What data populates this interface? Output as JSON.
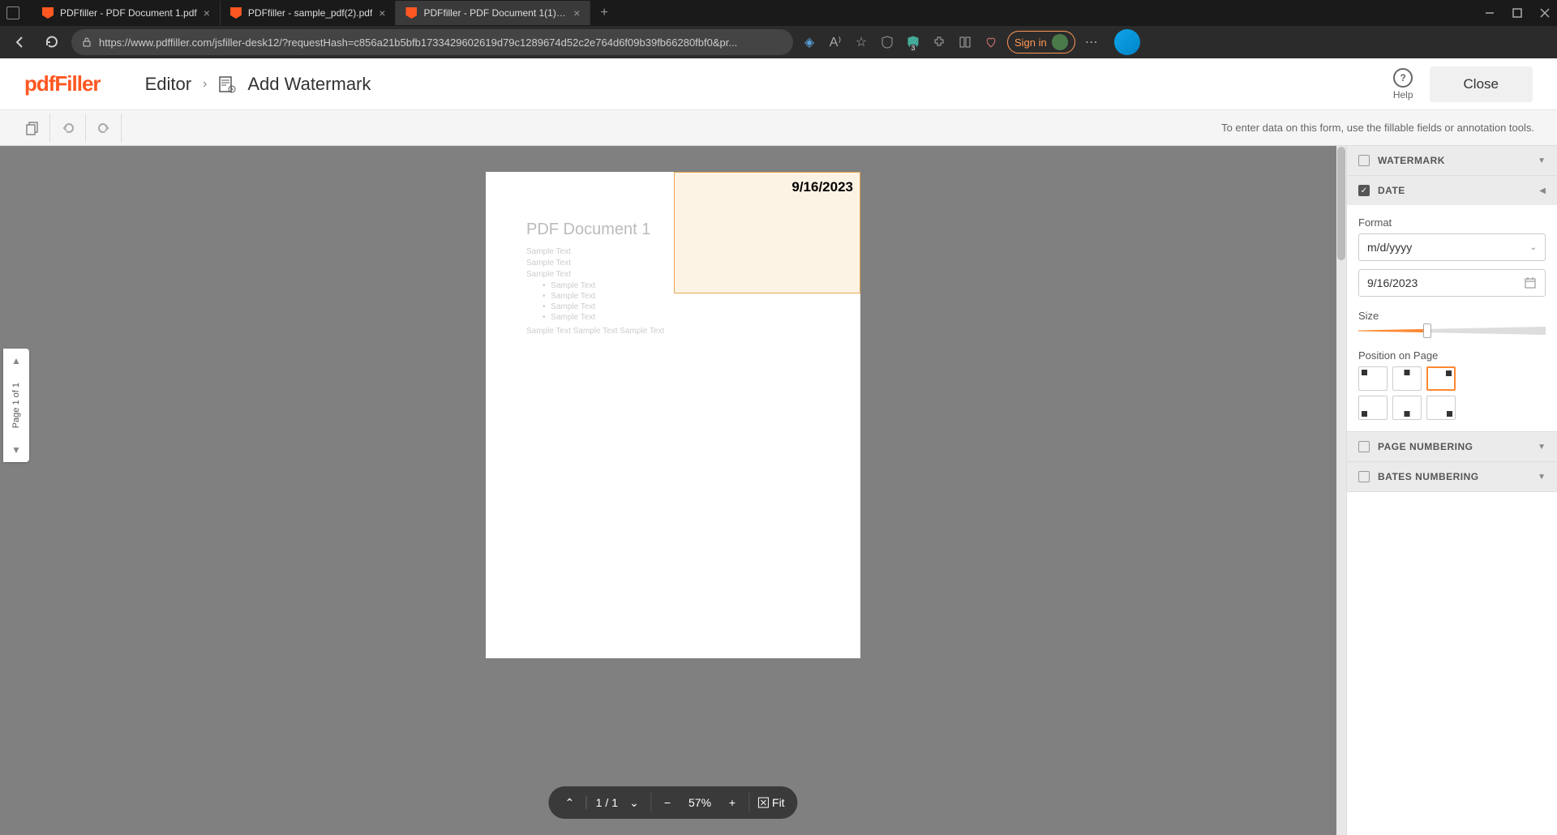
{
  "browser": {
    "tabs": [
      {
        "title": "PDFfiller - PDF Document 1.pdf"
      },
      {
        "title": "PDFfiller - sample_pdf(2).pdf"
      },
      {
        "title": "PDFfiller - PDF Document 1(1).pd"
      }
    ],
    "url": "https://www.pdffiller.com/jsfiller-desk12/?requestHash=c856a21b5bfb1733429602619d79c1289674d52c2e764d6f09b39fb66280fbf0&pr...",
    "signin": "Sign in"
  },
  "app": {
    "logo": "pdfFiller",
    "breadcrumb": {
      "editor": "Editor",
      "current": "Add Watermark"
    },
    "help": "Help",
    "close": "Close",
    "hint": "To enter data on this form, use the fillable fields or annotation tools."
  },
  "page_nav": {
    "text": "Page 1 of 1"
  },
  "document": {
    "title": "PDF Document 1",
    "lines": [
      "Sample Text",
      "Sample Text",
      "Sample Text"
    ],
    "bullets": [
      "Sample Text",
      "Sample Text",
      "Sample Text",
      "Sample Text"
    ],
    "footer": "Sample Text Sample Text Sample Text",
    "watermark_date": "9/16/2023"
  },
  "zoom": {
    "page": "1",
    "total": "/ 1",
    "percent": "57%",
    "fit": "Fit"
  },
  "panel": {
    "watermark": {
      "title": "WATERMARK"
    },
    "date": {
      "title": "DATE",
      "format_label": "Format",
      "format_value": "m/d/yyyy",
      "date_value": "9/16/2023",
      "size_label": "Size",
      "position_label": "Position on Page"
    },
    "page_numbering": {
      "title": "PAGE NUMBERING"
    },
    "bates": {
      "title": "BATES NUMBERING"
    }
  }
}
